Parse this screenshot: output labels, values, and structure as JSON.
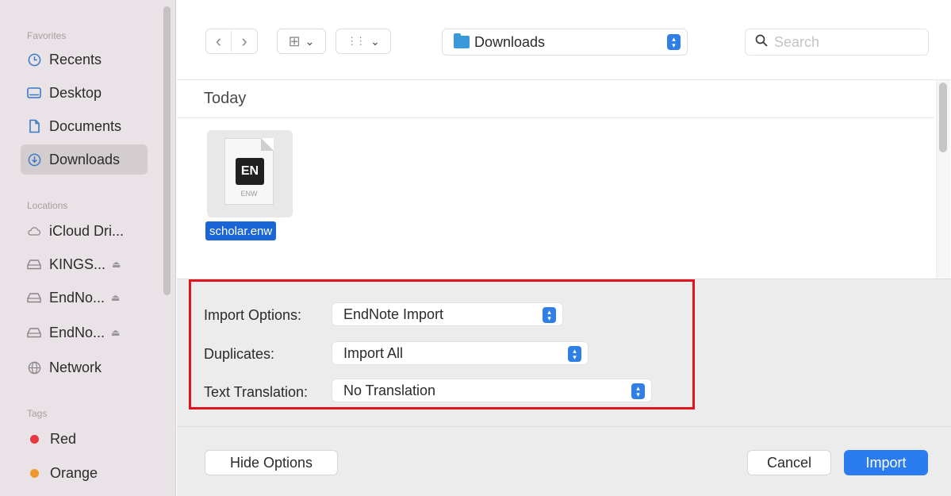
{
  "sidebar": {
    "favorites_heading": "Favorites",
    "favorites": [
      {
        "label": "Recents",
        "icon": "clock-icon"
      },
      {
        "label": "Desktop",
        "icon": "desktop-icon"
      },
      {
        "label": "Documents",
        "icon": "document-icon"
      },
      {
        "label": "Downloads",
        "icon": "download-icon",
        "selected": true
      }
    ],
    "locations_heading": "Locations",
    "locations": [
      {
        "label": "iCloud Dri...",
        "icon": "cloud-icon"
      },
      {
        "label": "KINGS...",
        "icon": "drive-icon",
        "eject": true
      },
      {
        "label": "EndNo...",
        "icon": "drive-icon",
        "eject": true
      },
      {
        "label": "EndNo...",
        "icon": "drive-icon",
        "eject": true
      },
      {
        "label": "Network",
        "icon": "network-icon"
      }
    ],
    "tags_heading": "Tags",
    "tags": [
      {
        "label": "Red",
        "color": "#e8373f"
      },
      {
        "label": "Orange",
        "color": "#f0962e"
      }
    ]
  },
  "toolbar": {
    "back_glyph": "‹",
    "forward_glyph": "›",
    "icon_view_glyph": "⊞",
    "group_view_glyph": "⋮⋮",
    "chevron": "⌄",
    "folder_label": "Downloads",
    "search_placeholder": "Search",
    "search_glyph": "⌕"
  },
  "files": {
    "group_heading": "Today",
    "items": [
      {
        "name": "scholar.enw",
        "badge": "EN",
        "kind": "ENW"
      }
    ]
  },
  "options": {
    "import_options_label": "Import Options:",
    "import_options_value": "EndNote Import",
    "duplicates_label": "Duplicates:",
    "duplicates_value": "Import All",
    "text_translation_label": "Text Translation:",
    "text_translation_value": "No Translation"
  },
  "buttons": {
    "hide_options": "Hide Options",
    "cancel": "Cancel",
    "import": "Import"
  },
  "colors": {
    "accent": "#2b7cf0",
    "highlight_box": "#e0131f",
    "selection": "#1a66d6"
  }
}
